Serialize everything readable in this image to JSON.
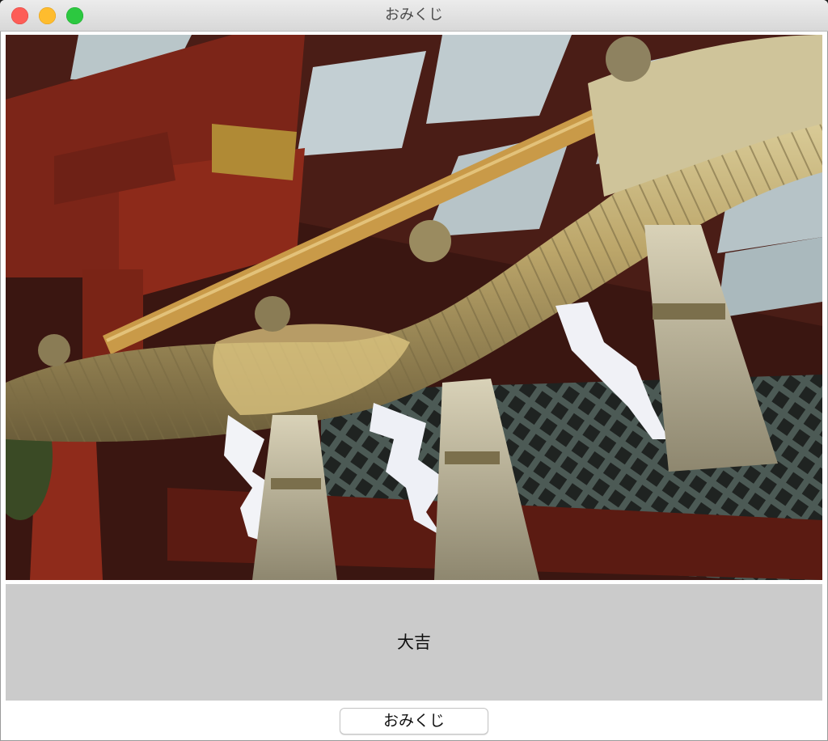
{
  "window": {
    "title": "おみくじ"
  },
  "image": {
    "subject": "shimenawa-straw-rope"
  },
  "fortune": {
    "result": "大吉"
  },
  "actions": {
    "draw_button_label": "おみくじ"
  },
  "colors": {
    "close": "#fd5d57",
    "minimize": "#febc2e",
    "maximize": "#2cc840",
    "fortune_panel": "#cbcbcb"
  }
}
